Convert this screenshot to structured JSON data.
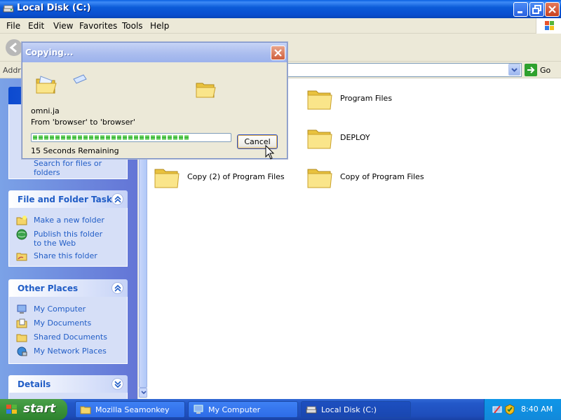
{
  "window": {
    "title": "Local Disk (C:)",
    "menu": [
      "File",
      "Edit",
      "View",
      "Favorites",
      "Tools",
      "Help"
    ],
    "address_label": "Address",
    "go_label": "Go"
  },
  "taskpane": {
    "partial_panel_link": "Search for files or folders",
    "file_folder_tasks": {
      "title": "File and Folder Tasks",
      "items": [
        {
          "label": "Make a new folder",
          "icon": "new-folder-icon"
        },
        {
          "label": "Publish this folder to the Web",
          "icon": "globe-icon"
        },
        {
          "label": "Share this folder",
          "icon": "share-folder-icon"
        }
      ]
    },
    "other_places": {
      "title": "Other Places",
      "items": [
        {
          "label": "My Computer",
          "icon": "computer-icon"
        },
        {
          "label": "My Documents",
          "icon": "documents-icon"
        },
        {
          "label": "Shared Documents",
          "icon": "folder-icon"
        },
        {
          "label": "My Network Places",
          "icon": "network-icon"
        }
      ]
    },
    "details": {
      "title": "Details"
    }
  },
  "content": {
    "items": [
      {
        "name": "Program Files"
      },
      {
        "name": "DEPLOY"
      },
      {
        "name": "Copy (2) of Program Files"
      },
      {
        "name": "Copy of Program Files"
      }
    ]
  },
  "dialog": {
    "title": "Copying...",
    "file_name": "omni.ja",
    "from_to": "From 'browser' to 'browser'",
    "progress_fraction": 0.81,
    "remaining": "15 Seconds Remaining",
    "cancel_label": "Cancel"
  },
  "taskbar": {
    "start_label": "start",
    "buttons": [
      {
        "label": "Mozilla Seamonkey",
        "active": false
      },
      {
        "label": "My Computer",
        "active": false
      },
      {
        "label": "Local Disk (C:)",
        "active": true
      }
    ],
    "clock": "8:40 AM"
  },
  "colors": {
    "titlebar_blue": "#0a4fd0",
    "taskpane_link": "#215dc6",
    "start_green": "#3c943c",
    "progress_green": "#2fb42f"
  }
}
